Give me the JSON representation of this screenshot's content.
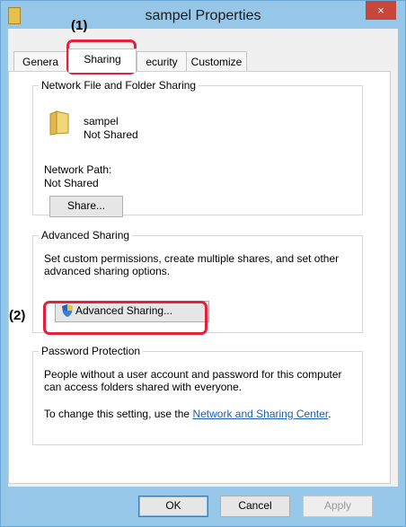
{
  "window": {
    "title": "sampel Properties",
    "close_glyph": "×"
  },
  "tabs": [
    {
      "label": "Genera"
    },
    {
      "label": "Sharing"
    },
    {
      "label": "ecurity"
    },
    {
      "label": "Customize"
    }
  ],
  "network_sharing": {
    "legend": "Network File and Folder Sharing",
    "item_name": "sampel",
    "item_status": "Not Shared",
    "path_label": "Network Path:",
    "path_value": "Not Shared",
    "share_button": "Share..."
  },
  "advanced_sharing": {
    "legend": "Advanced Sharing",
    "description_line1": "Set custom permissions, create multiple shares, and set other",
    "description_line2": "advanced sharing options.",
    "button": "Advanced Sharing..."
  },
  "password_protection": {
    "legend": "Password Protection",
    "line1": "People without a user account and password for this computer",
    "line2": "can access folders shared with everyone.",
    "change_prefix": "To change this setting, use the ",
    "link": "Network and Sharing Center",
    "change_suffix": "."
  },
  "footer": {
    "ok": "OK",
    "cancel": "Cancel",
    "apply": "Apply"
  },
  "callouts": {
    "one": "(1)",
    "two": "(2)"
  },
  "colors": {
    "callout": "#e4203a",
    "titlebar": "#97c7e8",
    "close": "#c9463d",
    "link": "#1a5fb4"
  },
  "icons": {
    "folder": "folder-icon",
    "shield": "shield-icon"
  }
}
